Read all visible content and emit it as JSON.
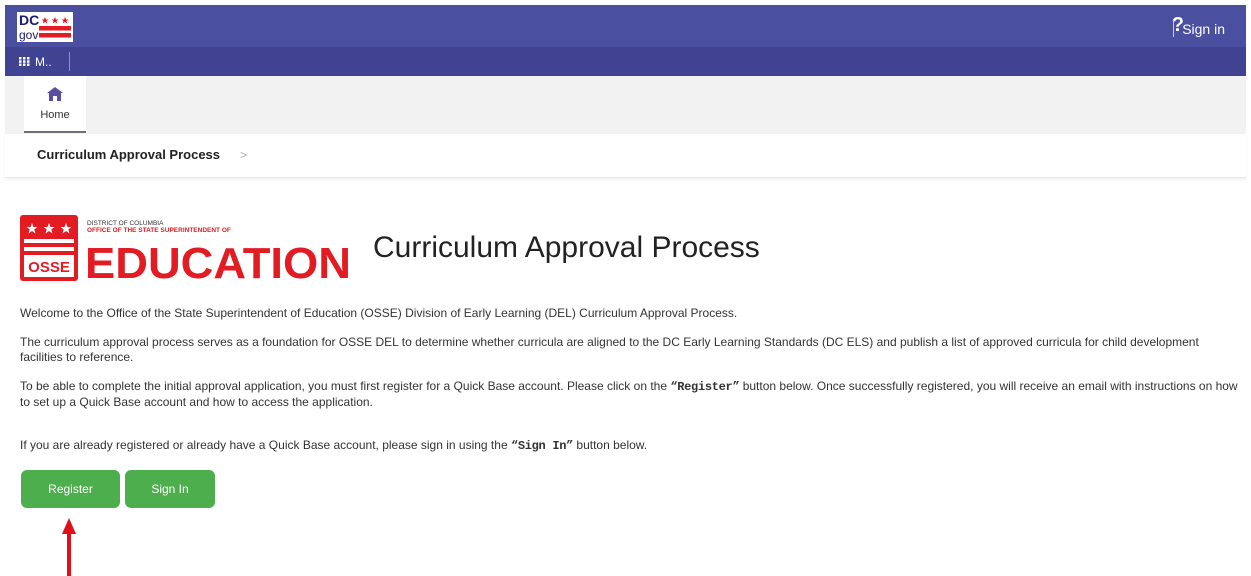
{
  "topbar": {
    "logo_text_top": "DC",
    "logo_text_bottom": "gov",
    "help_label": "?",
    "signin_label": "Sign in"
  },
  "appbar": {
    "apps_label": "M.."
  },
  "tabs": {
    "home_label": "Home"
  },
  "breadcrumb": {
    "label": "Curriculum Approval Process",
    "chevron": ">"
  },
  "logo": {
    "line1": "DISTRICT OF COLUMBIA",
    "line2": "OFFICE OF THE STATE SUPERINTENDENT OF",
    "big": "EDUCATION",
    "badge": "OSSE"
  },
  "page": {
    "title": "Curriculum Approval Process",
    "p1": "Welcome to the Office of the State Superintendent of Education (OSSE) Division of Early Learning (DEL) Curriculum Approval Process.",
    "p2": "The curriculum approval process serves as a foundation for OSSE DEL to determine whether curricula are aligned to the DC Early Learning Standards (DC ELS) and publish a list of approved curricula for child development facilities to reference.",
    "p3_a": "To be able to complete the initial approval application, you must first register for a Quick Base account. Please click on the ",
    "p3_b": "“Register”",
    "p3_c": " button below. Once successfully registered, you will receive an email with instructions on how to set up a Quick Base account and how to access the application.",
    "p4_a": "If you are already registered or already have a Quick Base account, please sign in using the ",
    "p4_b": "“Sign In”",
    "p4_c": " button below."
  },
  "buttons": {
    "register": "Register",
    "signin": "Sign In"
  },
  "colors": {
    "topbar": "#4a4fa0",
    "appbar": "#3f4391",
    "dc_red": "#e31b23",
    "button_green": "#4cae4c",
    "arrow": "#e0101b"
  },
  "icons": [
    "dc-flag-icon",
    "apps-grid-icon",
    "home-icon",
    "osse-stars-icon",
    "up-arrow-icon"
  ]
}
